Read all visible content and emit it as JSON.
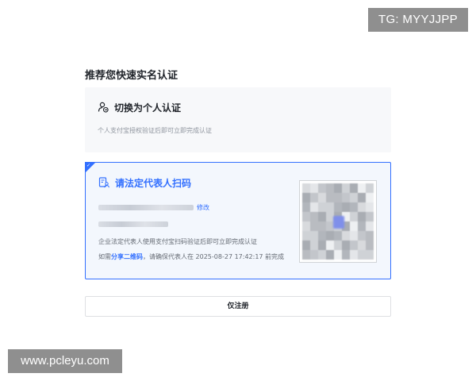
{
  "watermarks": {
    "top": "TG: MYYJJPP",
    "bottom": "www.pcleyu.com"
  },
  "page": {
    "title": "推荐您快速实名认证"
  },
  "personal_option": {
    "title": "切换为个人认证",
    "description": "个人支付宝授权验证后即可立即完成认证",
    "icon": "person-switch-icon"
  },
  "legal_rep_option": {
    "title": "请法定代表人扫码",
    "icon": "document-person-icon",
    "selected": true,
    "modify_label": "修改",
    "description": "企业法定代表人使用支付宝扫码验证后即可立即完成认证",
    "share_prefix": "如需",
    "share_link": "分享二维码",
    "share_suffix": "，请确保代表人在 2025-08-27 17:42:17 前完成"
  },
  "register_button": {
    "label": "仅注册"
  },
  "colors": {
    "accent": "#3370ff",
    "selected_bg": "#f3f7fd",
    "card_bg": "#f7f8fa"
  }
}
